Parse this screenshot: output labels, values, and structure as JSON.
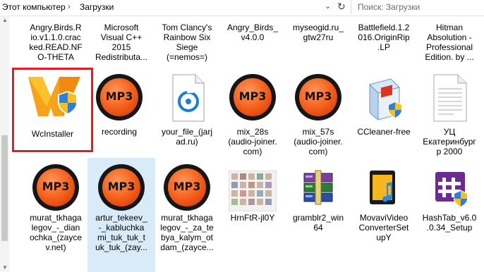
{
  "address": {
    "crumbs": [
      "Этот компьютер",
      "Загрузки"
    ],
    "separator": "›",
    "dropdown_icon": "chevron-down-icon",
    "refresh_icon": "refresh-icon"
  },
  "search": {
    "placeholder": "Поиск: Загрузки"
  },
  "rows": [
    [
      {
        "label": "Angry.Birds.R\nio.v1.1.0.crac\nked.READ.NF\nO-THETA"
      },
      {
        "label": "Microsoft\nVisual C++\n2015\nRedistributa..."
      },
      {
        "label": "Tom Clancy's\nRainbow Six\nSiege\n(=nemos=)"
      },
      {
        "label": "Angry_Birds_\nv4.0.0"
      },
      {
        "label": "myseogid.ru_\ngtw27ru"
      },
      {
        "label": "Battlefield.1.2\n016.OriginRip\n.LP"
      },
      {
        "label": "Hitman\nAbsolution -\nProfessional\nEdition. by ..."
      }
    ],
    [
      {
        "label": "WcInstaller",
        "icon": "wcinstaller-icon"
      },
      {
        "label": "recording",
        "icon": "mp3-icon"
      },
      {
        "label": "your_file_(jarj\nad.ru)",
        "icon": "audio-file-icon"
      },
      {
        "label": "mix_28s\n(audio-joiner.\ncom)",
        "icon": "mp3-icon"
      },
      {
        "label": "mix_57s\n(audio-joiner.\ncom)",
        "icon": "mp3-icon"
      },
      {
        "label": "CCleaner-free",
        "icon": "installer-box-icon"
      },
      {
        "label": "УЦ\nЕкатеринбург\nр 2000",
        "icon": "document-icon"
      }
    ],
    [
      {
        "label": "murat_tkhaga\nlegov_-_dian\nochka_(zayce\nv.net)",
        "icon": "mp3-icon"
      },
      {
        "label": "artur_tekeev_\n-_kabluchka\nmi_tuk_tuk_t\nuk_tuk_(zay...",
        "icon": "mp3-icon"
      },
      {
        "label": "murat_tkhaga\nlegov_-_za_te\nbya_kalym_ot\ndam_(zayce...",
        "icon": "mp3-icon"
      },
      {
        "label": "HrnFtR-jl0Y",
        "icon": "image-thumbnail-icon"
      },
      {
        "label": "gramblr2_win\n64",
        "icon": "winrar-archive-icon"
      },
      {
        "label": "MovaviVideo\nConverterSet\nupY",
        "icon": "movavi-icon"
      },
      {
        "label": "HashTab_v6.0\n.0.34_Setup",
        "icon": "hashtab-icon"
      }
    ]
  ],
  "mp3_text": "MP3",
  "colors": {
    "highlight": "#e31b23",
    "selected": "#d9ebf9",
    "mp3_orange": "#f35a17"
  }
}
